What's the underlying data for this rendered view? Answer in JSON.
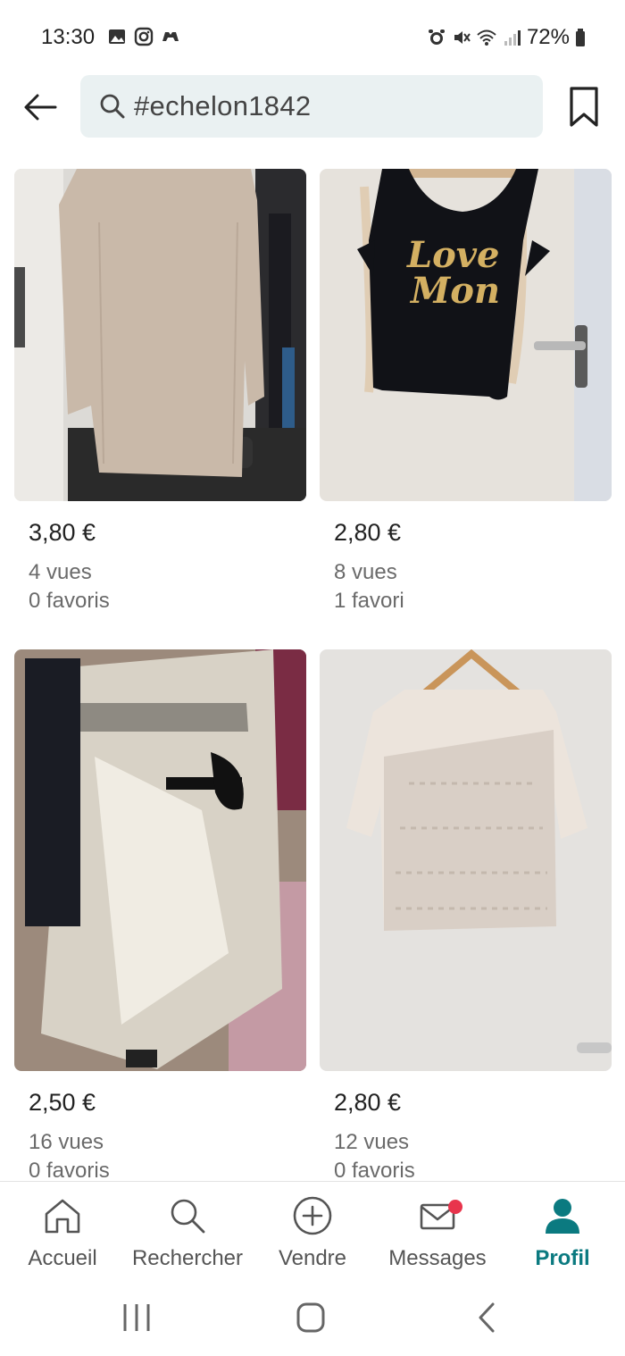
{
  "status_bar": {
    "time": "13:30",
    "battery": "72%",
    "left_icons": [
      "gallery-icon",
      "instagram-icon",
      "game-icon"
    ],
    "right_icons": [
      "alarm-icon",
      "mute-icon",
      "wifi-icon",
      "signal-icon",
      "battery-icon"
    ]
  },
  "header": {
    "search_value": "#echelon1842"
  },
  "items": [
    {
      "price": "3,80 €",
      "views": "4 vues",
      "favorites": "0 favoris",
      "image": "beige-sweater"
    },
    {
      "price": "2,80 €",
      "views": "8 vues",
      "favorites": "1 favori",
      "image": "black-tank-top"
    },
    {
      "price": "2,50 €",
      "views": "16 vues",
      "favorites": "0 favoris",
      "image": "beige-satin-top"
    },
    {
      "price": "2,80 €",
      "views": "12 vues",
      "favorites": "0 favoris",
      "image": "lace-top"
    }
  ],
  "bottom_nav": {
    "items": [
      {
        "label": "Accueil",
        "icon": "home-icon"
      },
      {
        "label": "Rechercher",
        "icon": "search-icon"
      },
      {
        "label": "Vendre",
        "icon": "plus-circle-icon"
      },
      {
        "label": "Messages",
        "icon": "mail-icon"
      },
      {
        "label": "Profil",
        "icon": "profile-icon"
      }
    ],
    "active": "Profil",
    "accent_color": "#0b7a80",
    "badge_color": "#e8344c"
  }
}
